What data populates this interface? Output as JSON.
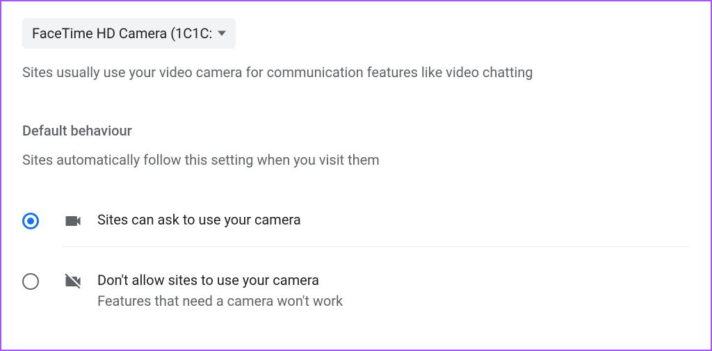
{
  "camera_dropdown": {
    "selected_label": "FaceTime HD Camera (1C1C:"
  },
  "description": "Sites usually use your video camera for communication features like video chatting",
  "default_behavior": {
    "heading": "Default behaviour",
    "subtitle": "Sites automatically follow this setting when you visit them",
    "options": [
      {
        "label": "Sites can ask to use your camera",
        "sublabel": "",
        "selected": true
      },
      {
        "label": "Don't allow sites to use your camera",
        "sublabel": "Features that need a camera won't work",
        "selected": false
      }
    ]
  }
}
